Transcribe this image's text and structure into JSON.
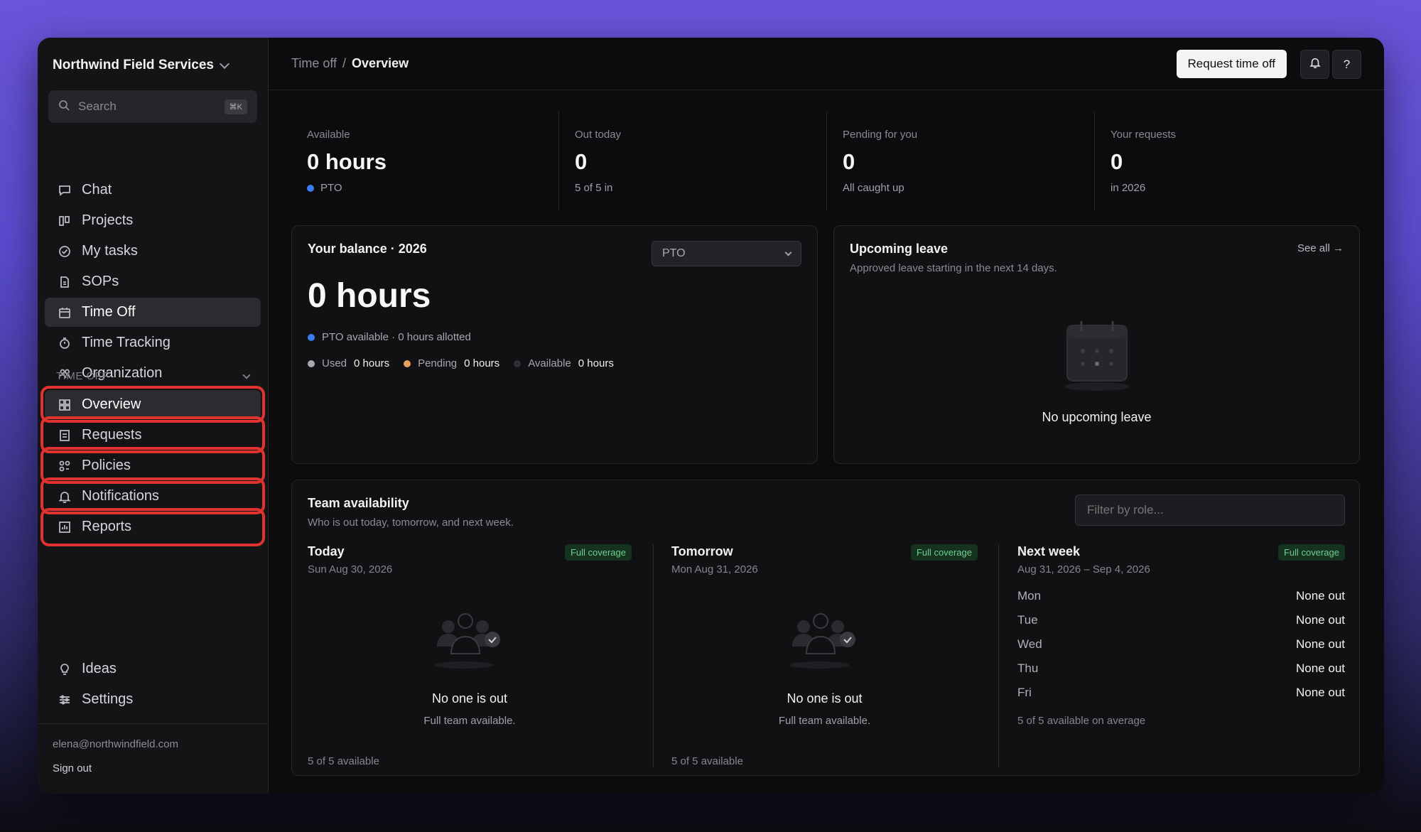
{
  "sidebar": {
    "org_name": "Northwind Field Services",
    "search_placeholder": "Search",
    "search_shortcut": "⌘K",
    "main_nav": [
      {
        "label": "Chat",
        "icon": "chat-icon"
      },
      {
        "label": "Projects",
        "icon": "board-icon"
      },
      {
        "label": "My tasks",
        "icon": "check-circle-icon"
      },
      {
        "label": "SOPs",
        "icon": "document-icon"
      },
      {
        "label": "Time Off",
        "icon": "calendar-icon",
        "active": true
      },
      {
        "label": "Time Tracking",
        "icon": "stopwatch-icon"
      },
      {
        "label": "Organization",
        "icon": "people-icon"
      }
    ],
    "section_label": "TIME OFF",
    "section_nav": [
      {
        "label": "Overview",
        "icon": "grid-icon",
        "active": true
      },
      {
        "label": "Requests",
        "icon": "list-doc-icon"
      },
      {
        "label": "Policies",
        "icon": "policy-icon"
      },
      {
        "label": "Notifications",
        "icon": "bell-icon"
      },
      {
        "label": "Reports",
        "icon": "bar-chart-icon"
      }
    ],
    "bottom_nav": [
      {
        "label": "Ideas",
        "icon": "lightbulb-icon"
      },
      {
        "label": "Settings",
        "icon": "sliders-icon"
      }
    ],
    "email": "elena@northwindfield.com",
    "sign_out": "Sign out"
  },
  "header": {
    "crumb_parent": "Time off",
    "crumb_sep": "/",
    "crumb_current": "Overview",
    "request_button": "Request time off",
    "help_label": "?"
  },
  "stats": [
    {
      "label": "Available",
      "value": "0 hours",
      "sub": "PTO",
      "dot_color": "#3b7cf0"
    },
    {
      "label": "Out today",
      "value": "0",
      "sub": "5 of 5 in"
    },
    {
      "label": "Pending for you",
      "value": "0",
      "sub": "All caught up"
    },
    {
      "label": "Your requests",
      "value": "0",
      "sub": "in 2026"
    }
  ],
  "balance": {
    "title": "Your balance · 2026",
    "select_value": "PTO",
    "total": "0 hours",
    "allotment_line": "PTO available · 0 hours allotted",
    "legend": [
      {
        "label": "Used",
        "value": "0 hours",
        "color": "#a8a8b0"
      },
      {
        "label": "Pending",
        "value": "0 hours",
        "color": "#e8a05c"
      },
      {
        "label": "Available",
        "value": "0 hours",
        "color": "#2e2e33"
      }
    ]
  },
  "upcoming": {
    "title": "Upcoming leave",
    "subtitle": "Approved leave starting in the next 14 days.",
    "see_all": "See all →",
    "empty": "No upcoming leave"
  },
  "team": {
    "title": "Team availability",
    "subtitle": "Who is out today, tomorrow, and next week.",
    "filter_placeholder": "Filter by role...",
    "today": {
      "title": "Today",
      "date": "Sun Aug 30, 2026",
      "badge": "Full coverage",
      "empty_title": "No one is out",
      "empty_sub": "Full team available.",
      "available": "5 of 5 available"
    },
    "tomorrow": {
      "title": "Tomorrow",
      "date": "Mon Aug 31, 2026",
      "badge": "Full coverage",
      "empty_title": "No one is out",
      "empty_sub": "Full team available.",
      "available": "5 of 5 available"
    },
    "next_week": {
      "title": "Next week",
      "date": "Aug 31, 2026 – Sep 4, 2026",
      "badge": "Full coverage",
      "days": [
        {
          "day": "Mon",
          "status": "None out"
        },
        {
          "day": "Tue",
          "status": "None out"
        },
        {
          "day": "Wed",
          "status": "None out"
        },
        {
          "day": "Thu",
          "status": "None out"
        },
        {
          "day": "Fri",
          "status": "None out"
        }
      ],
      "average": "5 of 5 available on average"
    }
  },
  "colors": {
    "highlight": "#e0322f",
    "accent_blue": "#3b7cf0",
    "coverage_green": "#6fcf8e"
  }
}
